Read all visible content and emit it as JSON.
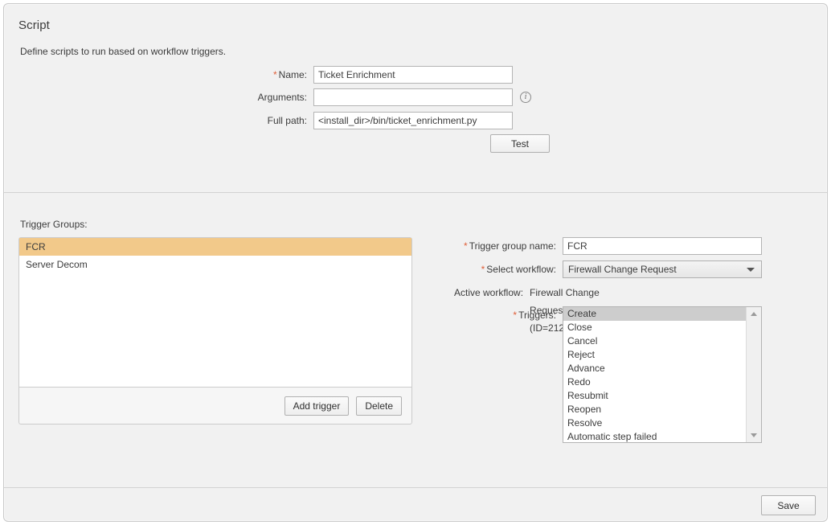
{
  "script_section": {
    "title": "Script",
    "description": "Define scripts to run based on workflow triggers.",
    "fields": {
      "name": {
        "label": "Name:",
        "required": true,
        "value": "Ticket Enrichment",
        "placeholder": ""
      },
      "arguments": {
        "label": "Arguments:",
        "required": false,
        "value": "",
        "placeholder": "",
        "info_icon": "info-circle-icon"
      },
      "full_path": {
        "label": "Full path:",
        "required": false,
        "value": "<install_dir>/bin/ticket_enrichment.py",
        "placeholder": ""
      }
    },
    "test_button": "Test"
  },
  "trigger_section": {
    "groups_label": "Trigger Groups:",
    "groups": [
      {
        "name": "FCR",
        "selected": true
      },
      {
        "name": "Server Decom",
        "selected": false
      }
    ],
    "list_buttons": {
      "add": "Add trigger",
      "delete": "Delete"
    },
    "detail": {
      "group_name": {
        "label": "Trigger group name:",
        "required": true,
        "value": "FCR",
        "placeholder": ""
      },
      "select_workflow": {
        "label": "Select workflow:",
        "required": true,
        "value": "Firewall Change Request",
        "arrow_icon": "chevron-down-icon"
      },
      "active_workflow": {
        "label": "Active workflow:",
        "required": false,
        "value": "Firewall Change Request (ID=212)"
      },
      "triggers": {
        "label": "Triggers:",
        "required": true,
        "items": [
          {
            "name": "Create",
            "selected": true
          },
          {
            "name": "Close",
            "selected": false
          },
          {
            "name": "Cancel",
            "selected": false
          },
          {
            "name": "Reject",
            "selected": false
          },
          {
            "name": "Advance",
            "selected": false
          },
          {
            "name": "Redo",
            "selected": false
          },
          {
            "name": "Resubmit",
            "selected": false
          },
          {
            "name": "Reopen",
            "selected": false
          },
          {
            "name": "Resolve",
            "selected": false
          },
          {
            "name": "Automatic step failed",
            "selected": false
          }
        ],
        "scroll_up_icon": "scroll-up-arrow-icon",
        "scroll_down_icon": "scroll-down-arrow-icon"
      }
    }
  },
  "footer": {
    "save_label": "Save"
  },
  "colors": {
    "selection_highlight": "#f2c98a",
    "list_selection": "#cdcdcd",
    "required_asterisk": "#e0603a",
    "panel_background": "#f1f1f1"
  }
}
